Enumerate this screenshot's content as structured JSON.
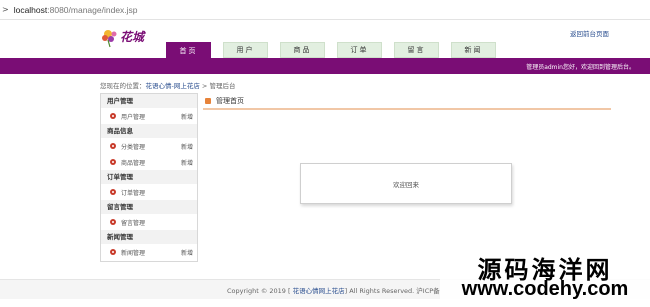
{
  "browser": {
    "url_host": "localhost",
    "url_rest": ":8080/manage/index.jsp"
  },
  "header": {
    "logo_text": "花城",
    "return_link": "返回前台页面",
    "nav": [
      {
        "label": "首页",
        "active": true
      },
      {
        "label": "用户",
        "active": false
      },
      {
        "label": "商品",
        "active": false
      },
      {
        "label": "订单",
        "active": false
      },
      {
        "label": "留言",
        "active": false
      },
      {
        "label": "新闻",
        "active": false
      }
    ],
    "admin_text": "管理员admin您好，欢迎回到管理后台。"
  },
  "breadcrumb": {
    "prefix": "您现在的位置：",
    "home": "花语心情-网上花店",
    "sep": " > ",
    "current": "管理后台"
  },
  "sidebar": {
    "sections": [
      {
        "title": "用户管理",
        "items": [
          {
            "label": "用户管理",
            "add": "新增"
          }
        ]
      },
      {
        "title": "商品信息",
        "items": [
          {
            "label": "分类管理",
            "add": "新增"
          },
          {
            "label": "商品管理",
            "add": "新增"
          }
        ]
      },
      {
        "title": "订单管理",
        "items": [
          {
            "label": "订单管理",
            "add": ""
          }
        ]
      },
      {
        "title": "留言管理",
        "items": [
          {
            "label": "留言管理",
            "add": ""
          }
        ]
      },
      {
        "title": "新闻管理",
        "items": [
          {
            "label": "新闻管理",
            "add": "新增"
          }
        ]
      }
    ]
  },
  "main": {
    "title": "管理首页",
    "welcome": "欢迎回来"
  },
  "footer": {
    "copy_prefix": "Copyright © 2019 [",
    "site": " 花语心情网上花店",
    "copy_suffix": "] All Rights Reserved. 沪ICP备"
  },
  "watermark": {
    "cn": "源码海洋网",
    "en": "www.codehy.com"
  },
  "colors": {
    "brand_purple": "#7a0d75",
    "tab_green": "#e2efe0",
    "link_blue": "#2a4e8f"
  }
}
